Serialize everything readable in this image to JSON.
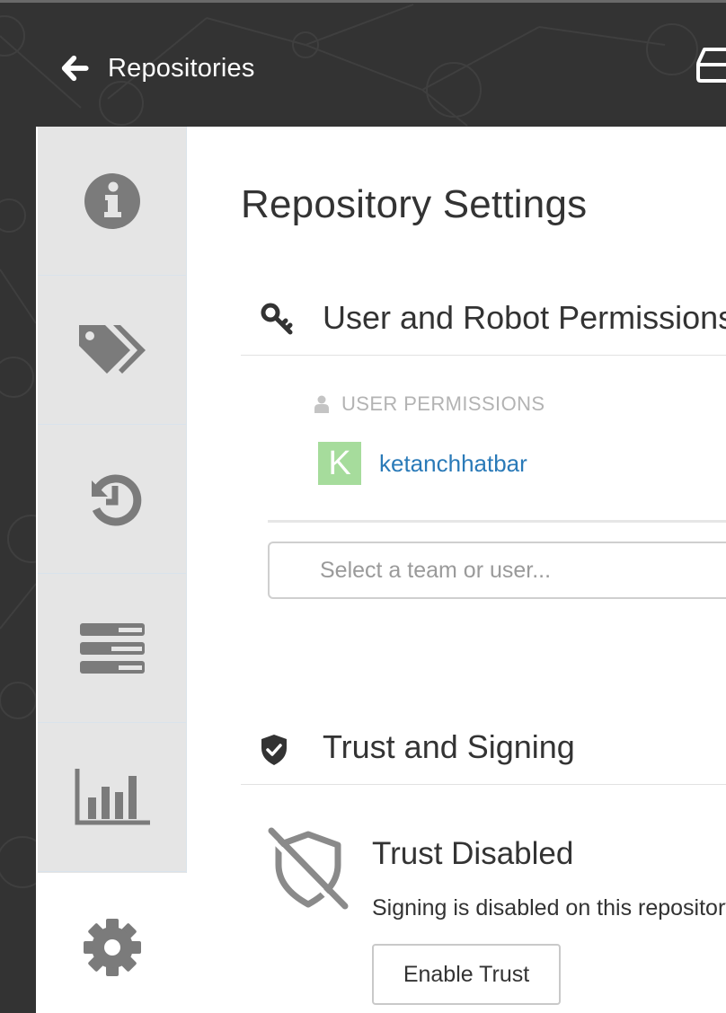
{
  "header": {
    "back_label": "Repositories",
    "back_icon": "arrow-left-icon",
    "right_icon": "drive-icon"
  },
  "sidebar": {
    "tabs": [
      {
        "name": "information",
        "icon": "info-circle-icon"
      },
      {
        "name": "tags",
        "icon": "tags-icon"
      },
      {
        "name": "tag-history",
        "icon": "history-icon"
      },
      {
        "name": "builds",
        "icon": "tasks-icon"
      },
      {
        "name": "usage-logs",
        "icon": "bar-chart-icon"
      },
      {
        "name": "settings",
        "icon": "gear-icon",
        "active": true
      }
    ]
  },
  "main": {
    "title": "Repository Settings",
    "permissions": {
      "heading": "User and Robot Permissions",
      "user_permissions_label": "USER PERMISSIONS",
      "users": [
        {
          "initial": "K",
          "name": "ketanchhatbar"
        }
      ],
      "team_input_placeholder": "Select a team or user..."
    },
    "trust": {
      "heading": "Trust and Signing",
      "status_title": "Trust Disabled",
      "description": "Signing is disabled on this repository.",
      "enable_button": "Enable Trust"
    }
  },
  "colors": {
    "header_bg": "#333333",
    "sidebar_bg": "#e5e5e5",
    "link": "#2a7ab8",
    "avatar_bg": "#a6dc9c",
    "text": "#333333",
    "muted": "#b3b3b3"
  }
}
